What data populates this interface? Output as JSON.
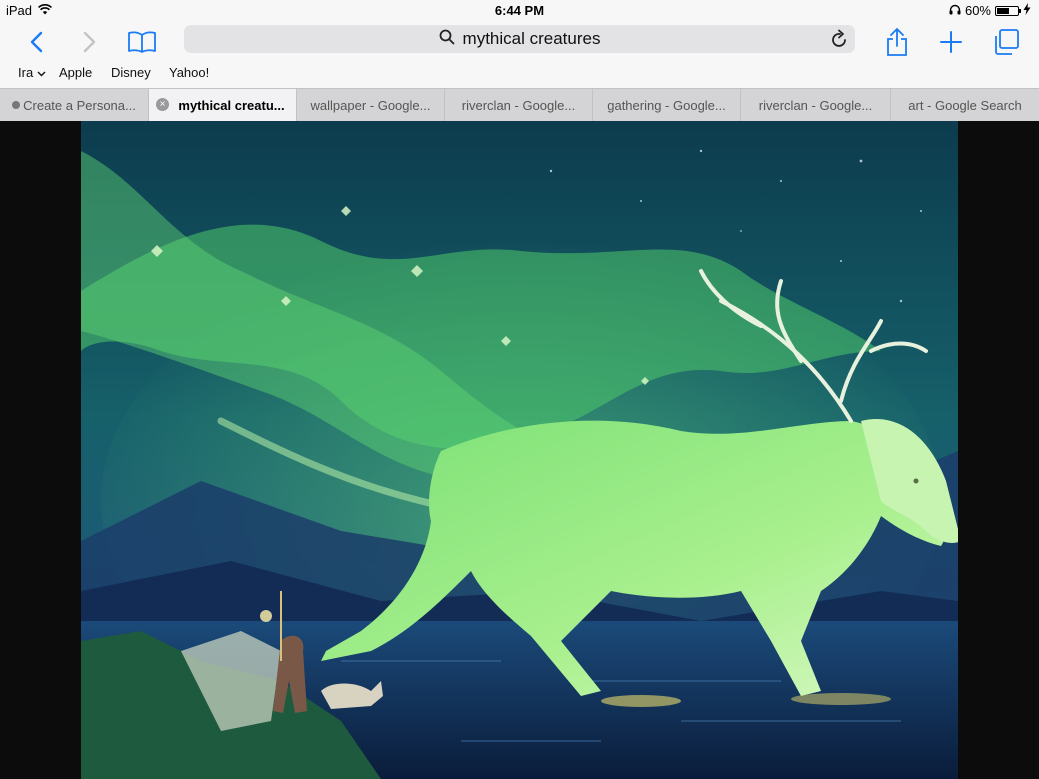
{
  "status": {
    "device": "iPad",
    "time": "6:44 PM",
    "battery": "60%",
    "battery_level": 0.6
  },
  "toolbar": {
    "search_query": "mythical creatures"
  },
  "favorites": [
    "Ira",
    "Apple",
    "Disney",
    "Yahoo!"
  ],
  "tabs": [
    {
      "label": "Create a Persona..."
    },
    {
      "label": "mythical creatu..."
    },
    {
      "label": "wallpaper - Google..."
    },
    {
      "label": "riverclan - Google..."
    },
    {
      "label": "gathering - Google..."
    },
    {
      "label": "riverclan - Google..."
    },
    {
      "label": "art - Google Search"
    }
  ],
  "colors": {
    "accent": "#1a7cf5",
    "chrome": "#f7f7f7",
    "tab_bar": "#d4d4d6"
  }
}
